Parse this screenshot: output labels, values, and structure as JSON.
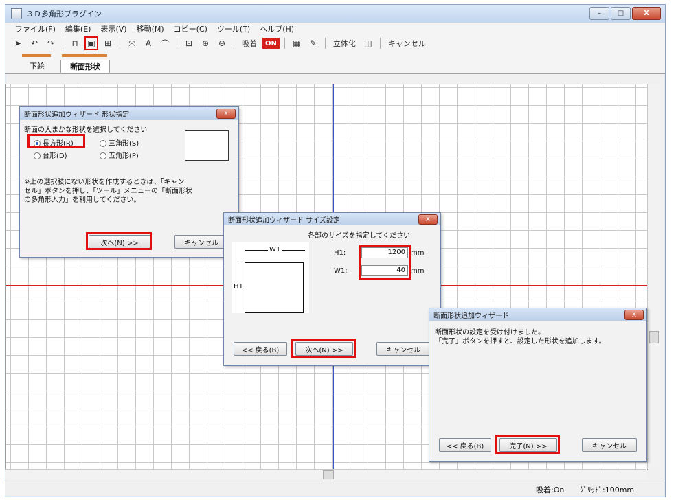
{
  "window": {
    "title": "３Ｄ多角形プラグイン",
    "caption_buttons": {
      "minimize": "–",
      "maximize": "□",
      "close": "X"
    }
  },
  "menu": [
    "ファイル(F)",
    "編集(E)",
    "表示(V)",
    "移動(M)",
    "コピー(C)",
    "ツール(T)",
    "ヘルプ(H)"
  ],
  "toolbar": {
    "text_label": "A",
    "snap_label": "吸着",
    "on_label": "ON",
    "solid_label": "立体化",
    "cancel_label": "キャンセル"
  },
  "tabs": [
    {
      "label": "下絵",
      "active": false
    },
    {
      "label": "断面形状",
      "active": true
    }
  ],
  "dialog_shape": {
    "title": "断面形状追加ウィザード 形状指定",
    "instruction": "断面の大まかな形状を選択してください",
    "options": [
      {
        "label": "長方形(R)",
        "selected": true
      },
      {
        "label": "三角形(S)",
        "selected": false
      },
      {
        "label": "台形(D)",
        "selected": false
      },
      {
        "label": "五角形(P)",
        "selected": false
      }
    ],
    "note_lines": [
      "※上の選択肢にない形状を作成するときは、「キャン",
      "セル」ボタンを押し、「ツール」メニューの「断面形状",
      "の多角形入力」を利用してください。"
    ],
    "next_label": "次へ(N) >>",
    "cancel_label": "キャンセル"
  },
  "dialog_size": {
    "title": "断面形状追加ウィザード サイズ設定",
    "instruction": "各部のサイズを指定してください",
    "w1_diagram": "W1",
    "h1_diagram": "H1",
    "h1_label": "H1:",
    "h1_value": "1200",
    "w1_label": "W1:",
    "w1_value": "40",
    "unit": "mm",
    "back_label": "<< 戻る(B)",
    "next_label": "次へ(N) >>",
    "cancel_label": "キャンセル"
  },
  "dialog_done": {
    "title": "断面形状追加ウィザード",
    "message_lines": [
      "断面形状の設定を受け付けました。",
      "「完了」ボタンを押すと、設定した形状を追加します。"
    ],
    "back_label": "<< 戻る(B)",
    "finish_label": "完了(N) >>",
    "cancel_label": "キャンセル"
  },
  "status": {
    "snap": "吸着:On",
    "grid": "ｸﾞﾘｯﾄﾞ:100mm"
  },
  "colors": {
    "accent_red": "#e01010",
    "axis_blue": "#3a55c8",
    "axis_red": "#d42020",
    "tab_accent": "#d9823a"
  }
}
